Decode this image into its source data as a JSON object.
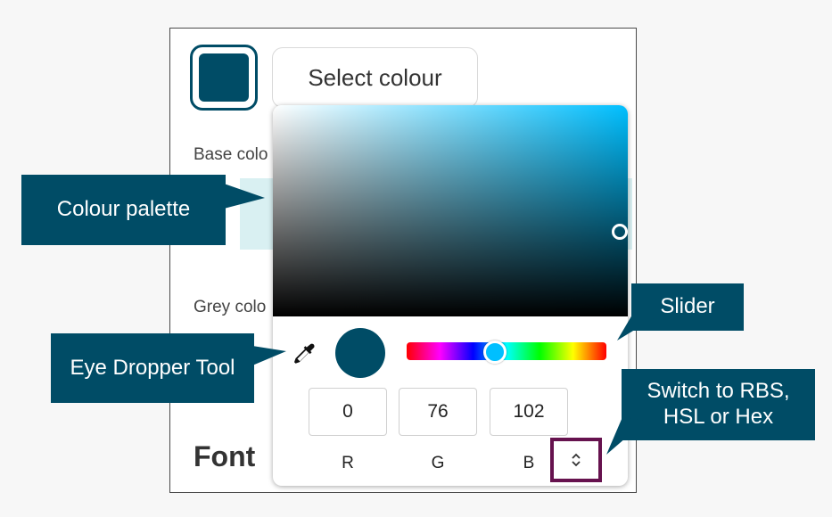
{
  "panel": {
    "select_button_label": "Select colour",
    "base_colours_label": "Base colo",
    "grey_colours_label": "Grey colo",
    "font_heading": "Font",
    "current_colour": "#004c66"
  },
  "picker": {
    "hue_color": "#00bfff",
    "rgb_values": [
      {
        "value": "0",
        "label": "R"
      },
      {
        "value": "76",
        "label": "G"
      },
      {
        "value": "102",
        "label": "B"
      }
    ],
    "dropper_icon": "eyedropper-icon",
    "toggle_icon": "chevron-up-down-icon"
  },
  "callouts": {
    "colour_palette": "Colour palette",
    "eye_dropper": "Eye Dropper Tool",
    "slider": "Slider",
    "switch_format_line1": "Switch to RBS,",
    "switch_format_line2": "HSL or Hex"
  },
  "colors": {
    "brand": "#004c66",
    "highlight_border": "#66124e"
  }
}
